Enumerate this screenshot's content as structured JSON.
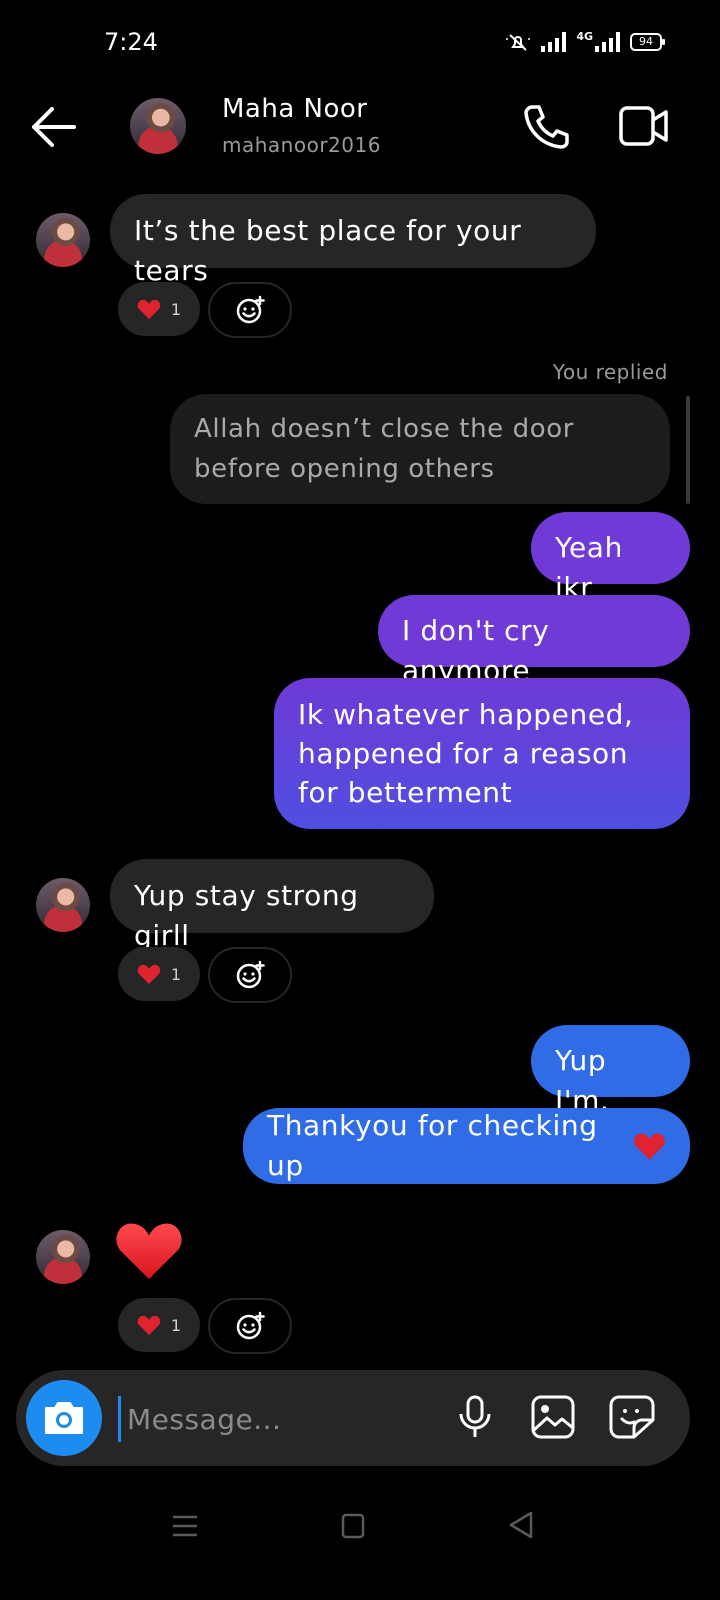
{
  "status_bar": {
    "time": "7:24",
    "battery": "94",
    "network": "4G"
  },
  "header": {
    "name": "Maha Noor",
    "username": "mahanoor2016"
  },
  "messages": {
    "m1": "It’s the best place for your tears",
    "replied_label": "You replied",
    "replied_quote": "Allah doesn’t close the door before opening others",
    "m2": "Yeah ikr",
    "m3": "I don't cry anymore",
    "m4": "Ik whatever happened, happened for a reason for betterment",
    "m5": "Yup stay strong girll",
    "m6": "Yup I'm.",
    "m7": "Thankyou for checking up",
    "m8": "❤️"
  },
  "reactions": {
    "r1_count": "1",
    "r2_count": "1",
    "r3_count": "1"
  },
  "composer": {
    "placeholder": "Message..."
  },
  "colors": {
    "accent_blue": "#1d8cf0",
    "incoming_bubble": "#262626",
    "outgoing_purple": "#6f3ad6",
    "outgoing_blue": "#2f6ce6",
    "heart": "#e0242f"
  },
  "icons": [
    "back-arrow-icon",
    "phone-icon",
    "video-camera-icon",
    "heart-icon",
    "add-reaction-icon",
    "camera-icon",
    "microphone-icon",
    "gallery-icon",
    "sticker-icon",
    "menu-icon",
    "home-icon",
    "back-nav-icon"
  ]
}
